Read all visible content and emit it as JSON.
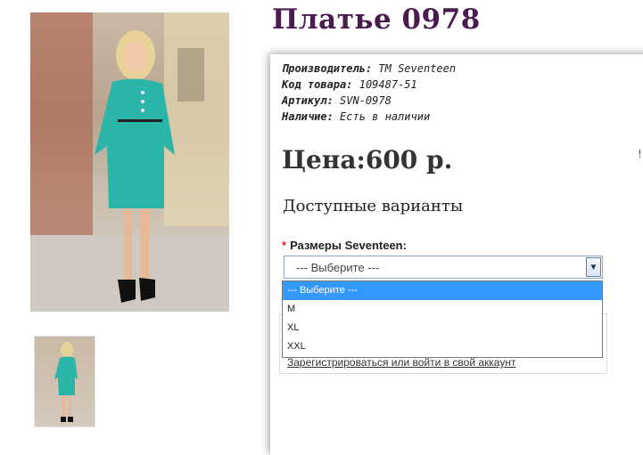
{
  "product": {
    "title": "Платье 0978",
    "images": {
      "main_alt": "main-product-photo",
      "thumb_alt": "thumbnail-photo"
    }
  },
  "specs": [
    {
      "label": "Производитель:",
      "value": "TM Seventeen"
    },
    {
      "label": "Код товара:",
      "value": "109487-51"
    },
    {
      "label": "Артикул:",
      "value": "SVN-0978"
    },
    {
      "label": "Наличие:",
      "value": "Есть в наличии"
    }
  ],
  "price": "Цена:600 р.",
  "options": {
    "heading": "Доступные варианты",
    "size_label": "Размеры Seventeen:",
    "required_mark": "*",
    "selected": "--- Выберите ---",
    "choices": [
      "--- Выберите ---",
      "M",
      "XL",
      "XXL"
    ]
  },
  "account": {
    "login_link": "Зарегистрироваться или войти в свой аккаунт"
  },
  "edge_mark": "!",
  "colors": {
    "title": "#4a1b4e",
    "dress": "#2ab5a8",
    "dropdown_highlight": "#3399ff",
    "required": "#e22222"
  }
}
